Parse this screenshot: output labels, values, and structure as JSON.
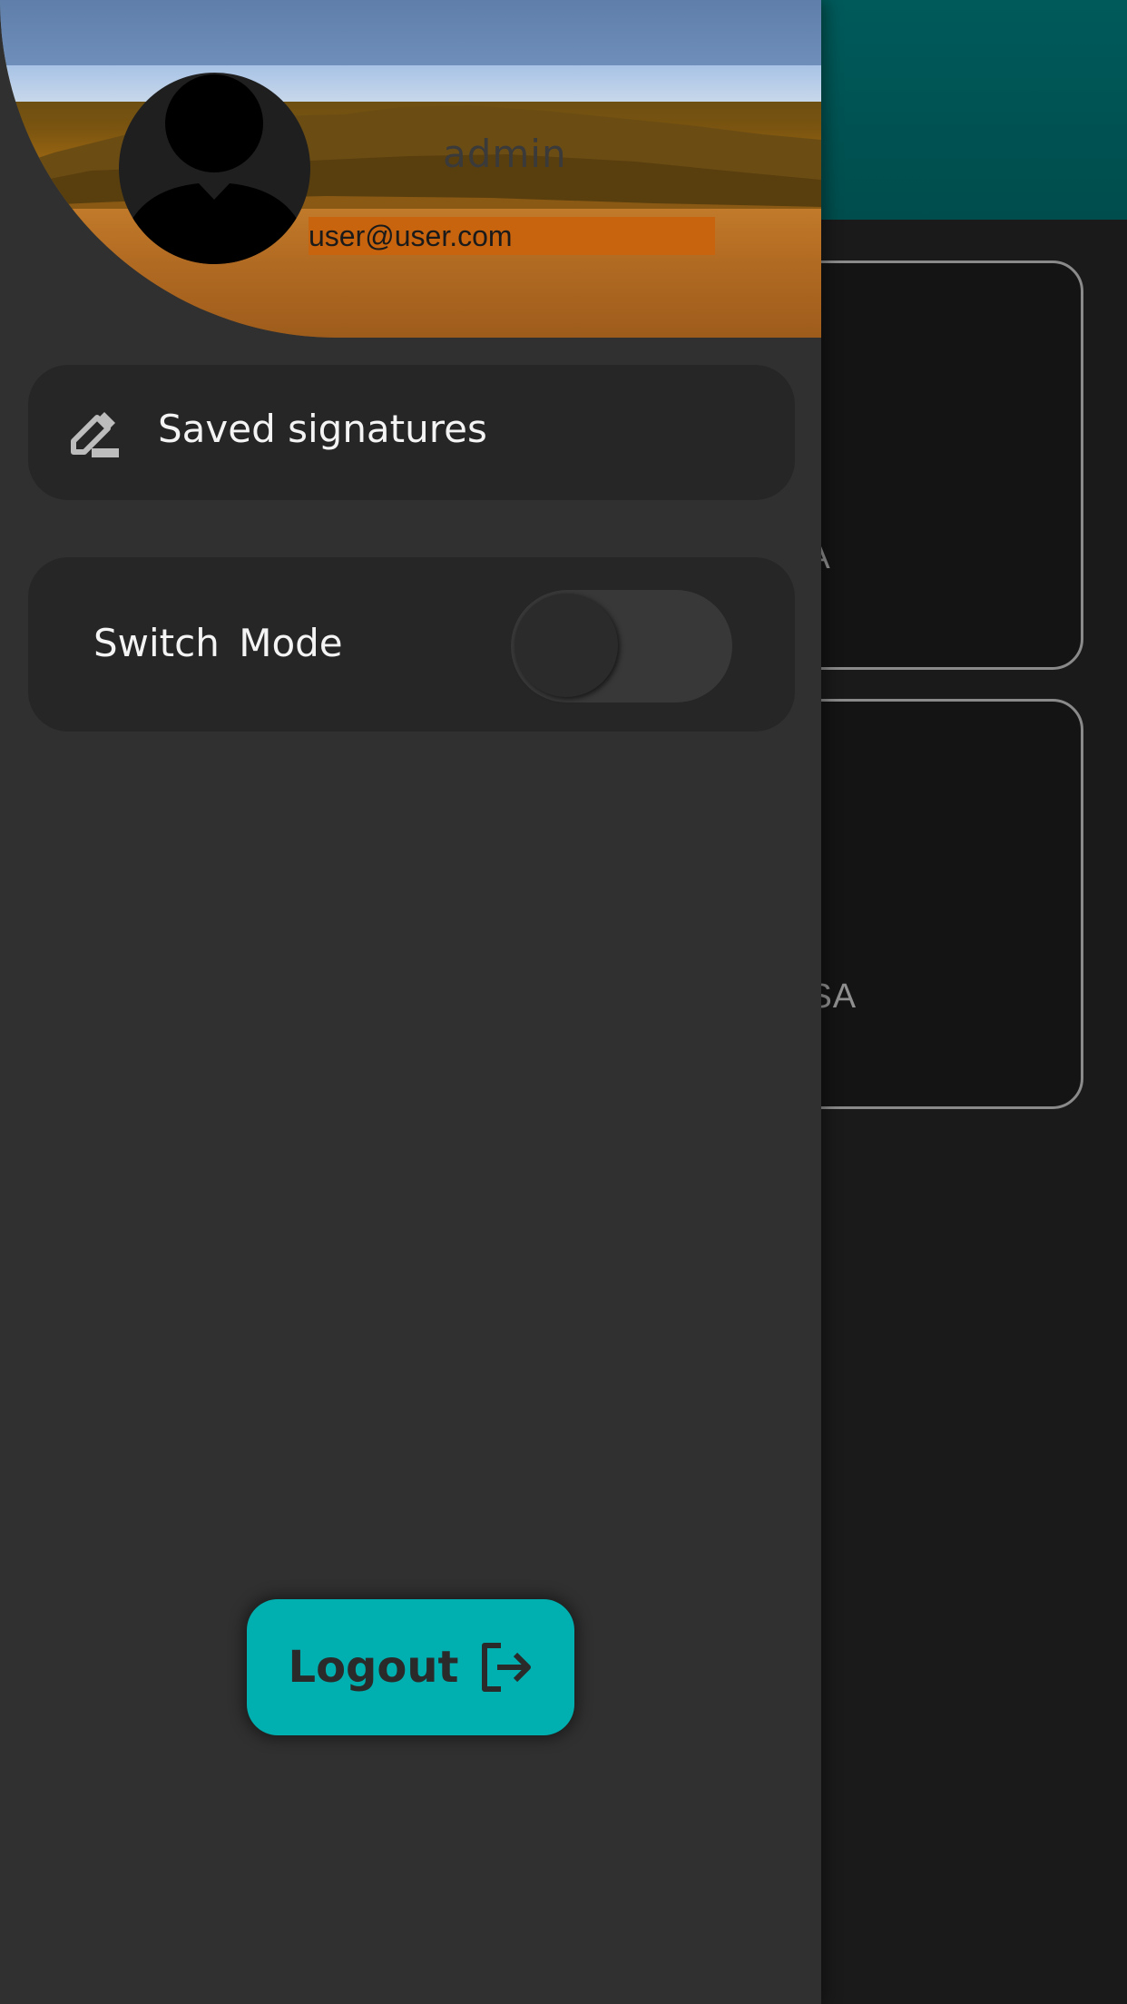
{
  "background": {
    "cards": [
      {
        "text": "SA"
      },
      {
        "text": "USA"
      }
    ]
  },
  "drawer": {
    "header": {
      "username": "admin",
      "email": "user@user.com"
    },
    "menu": {
      "saved_signatures_label": "Saved signatures",
      "switch_mode_label": "Switch  Mode",
      "switch_mode_on": false
    },
    "logout_label": "Logout"
  },
  "icons": {
    "saved_signatures": "pen-edit-icon",
    "logout": "logout-exit-icon",
    "avatar": "user-silhouette-icon"
  },
  "colors": {
    "accent": "#00b0b0",
    "drawer_bg": "#303030",
    "card_bg": "#262626",
    "appbar": "#005a5a",
    "email_highlight": "#c8640e"
  }
}
